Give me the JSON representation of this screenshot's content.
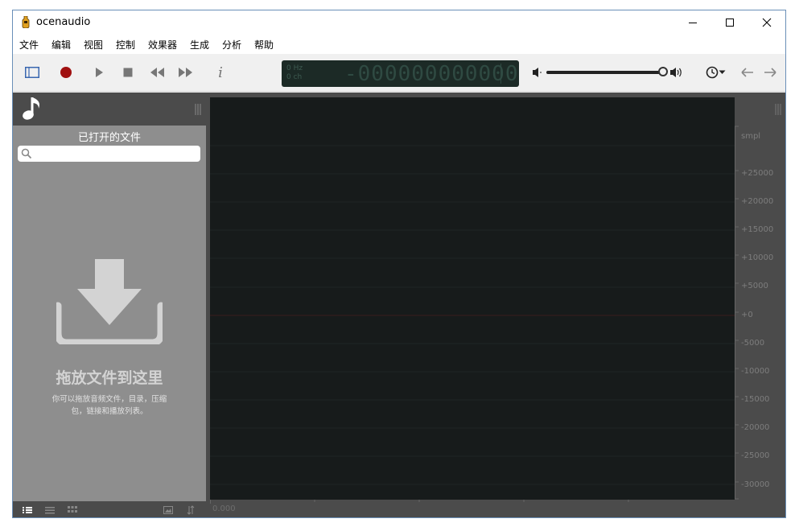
{
  "window": {
    "title": "ocenaudio",
    "controls": [
      "minimize",
      "maximize",
      "close"
    ]
  },
  "menu": [
    "文件",
    "编辑",
    "视图",
    "控制",
    "效果器",
    "生成",
    "分析",
    "帮助"
  ],
  "toolbar": {
    "buttons": [
      "sidebar-toggle-icon",
      "record-icon",
      "play-icon",
      "stop-icon",
      "rewind-icon",
      "fast-forward-icon",
      "info-icon"
    ],
    "info_glyph": "i",
    "display": {
      "hz": "0 Hz",
      "ch": "0 ch",
      "time": "-000000000000"
    },
    "volume_level": 0.98,
    "accent_color": "#3a67b0",
    "record_color": "#a01010"
  },
  "sidebar": {
    "title": "已打开的文件",
    "search_placeholder": "",
    "drop_title": "拖放文件到这里",
    "drop_description": "你可以拖放音频文件，目录，压缩包，链接和播放列表。"
  },
  "waveform": {
    "unit": "smpl",
    "ticks": [
      "+25000",
      "+20000",
      "+15000",
      "+10000",
      "+5000",
      "+0",
      "-5000",
      "-10000",
      "-15000",
      "-20000",
      "-25000",
      "-30000"
    ],
    "time_position": "0.000"
  }
}
